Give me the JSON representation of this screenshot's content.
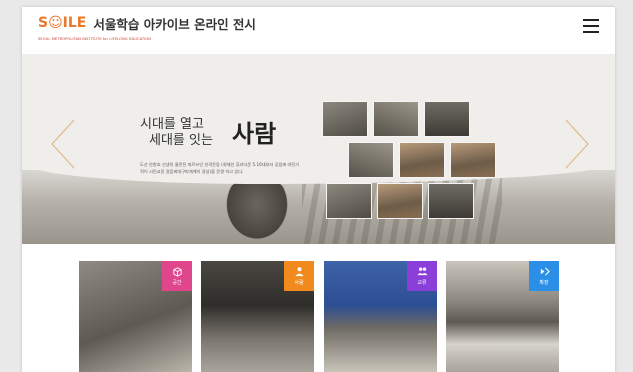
{
  "header": {
    "logo_mark": "S☺ILE",
    "title": "서울학습 아카이브 온라인 전시",
    "subtitle": "SEOUL METROPOLITAN INSTITUTE for LIFELONG EDUCATION",
    "menu_icon": "hamburger-icon"
  },
  "hero": {
    "line1": "시대를 열고",
    "line2": "세대를 잇는",
    "big": "사람",
    "description": "도산 안창호 선생의 물린된 따르쓰인 인곽운동 (회체인 휴리더운 5.16대부터 공립에 야진기적이 시민교장 걸음회대구파계계이 경성)을 문갱 하고 있다.",
    "prev_icon": "chevron-left-icon",
    "next_icon": "chevron-right-icon"
  },
  "colors": {
    "accent_orange": "#e8782a",
    "card_pink": "#e0468c",
    "card_orange": "#f08a1e",
    "card_purple": "#8b3fd9",
    "card_blue": "#2b8fe8"
  },
  "cards": [
    {
      "label": "공간",
      "icon": "cube-icon"
    },
    {
      "label": "사람",
      "icon": "person-icon"
    },
    {
      "label": "교류",
      "icon": "group-icon"
    },
    {
      "label": "확장",
      "icon": "expand-icon"
    }
  ]
}
